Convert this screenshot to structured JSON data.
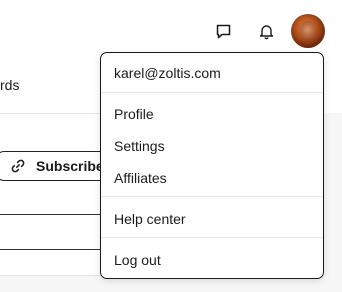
{
  "header": {
    "icons": {
      "chat": "chat-bubble-icon",
      "notifications": "bell-icon",
      "avatar": "user-avatar"
    }
  },
  "nav": {
    "partial_tab_label": "rds"
  },
  "main": {
    "subscribe_label": "Subscribe",
    "subscribe_icon": "link-icon"
  },
  "account_menu": {
    "email": "karel@zoltis.com",
    "items": [
      {
        "label": "Profile"
      },
      {
        "label": "Settings"
      },
      {
        "label": "Affiliates"
      },
      {
        "label": "Help center"
      },
      {
        "label": "Log out"
      }
    ]
  },
  "colors": {
    "text": "#1a1a1a",
    "menu_border": "#1a1a1a",
    "content_background": "#f7f7f7"
  }
}
